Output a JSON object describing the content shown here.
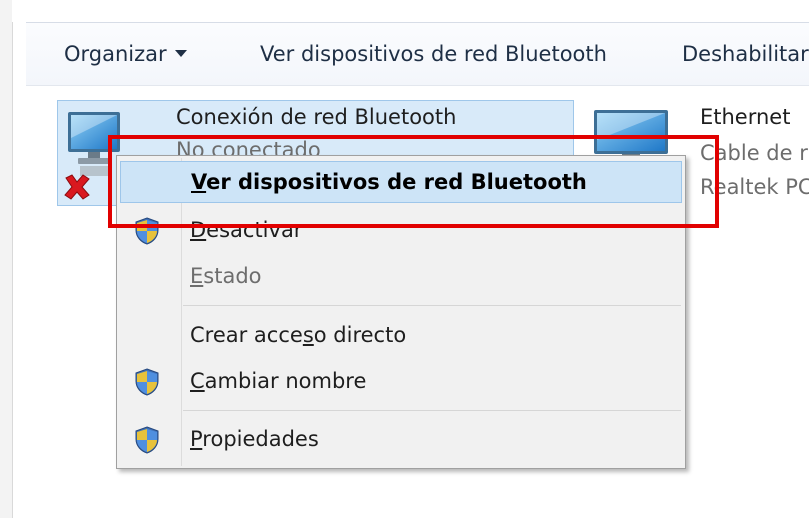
{
  "toolbar": {
    "organize_label": "Organizar",
    "view_bt_label": "Ver dispositivos de red Bluetooth",
    "disable_label": "Deshabilitar"
  },
  "connections": [
    {
      "name": "Conexión de red Bluetooth",
      "status": "No conectado",
      "error_icon": "red-x-icon"
    },
    {
      "name": "Ethernet",
      "status": "Cable de r",
      "device": "Realtek PC"
    }
  ],
  "context_menu": {
    "items": [
      {
        "pre": "",
        "u": "V",
        "post": "er dispositivos de red Bluetooth",
        "shield": false,
        "highlighted": true,
        "disabled": false
      },
      {
        "pre": "",
        "u": "D",
        "post": "esactivar",
        "shield": true,
        "highlighted": false,
        "disabled": false
      },
      {
        "pre": "",
        "u": "E",
        "post": "stado",
        "shield": false,
        "highlighted": false,
        "disabled": true
      },
      {
        "pre": "Crear acce",
        "u": "s",
        "post": "o directo",
        "shield": false,
        "highlighted": false,
        "disabled": false
      },
      {
        "pre": "",
        "u": "C",
        "post": "ambiar nombre",
        "shield": true,
        "highlighted": false,
        "disabled": false
      },
      {
        "pre": "",
        "u": "P",
        "post": "ropiedades",
        "shield": true,
        "highlighted": false,
        "disabled": false
      }
    ]
  },
  "colors": {
    "highlight_bg": "#cde4f7",
    "selection_bg": "#d8eaf9",
    "annotation_red": "#e10000"
  }
}
